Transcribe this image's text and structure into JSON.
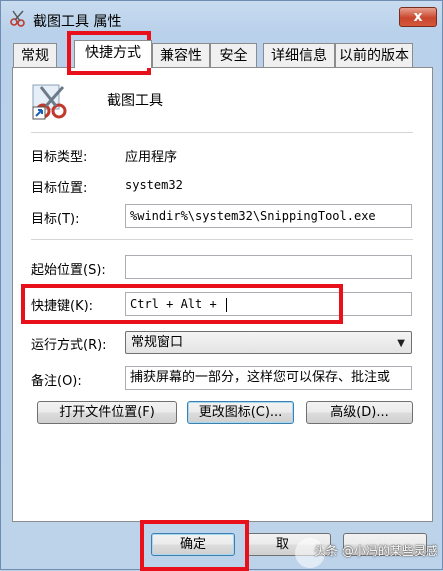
{
  "window": {
    "title": "截图工具 属性",
    "close_label": "x"
  },
  "tabs": [
    {
      "label": "常规"
    },
    {
      "label": "快捷方式"
    },
    {
      "label": "兼容性"
    },
    {
      "label": "安全"
    },
    {
      "label": "详细信息"
    },
    {
      "label": "以前的版本"
    }
  ],
  "shortcut": {
    "name": "截图工具",
    "target_type_label": "目标类型:",
    "target_type": "应用程序",
    "target_location_label": "目标位置:",
    "target_location": "system32",
    "target_label": "目标(T):",
    "target": "%windir%\\system32\\SnippingTool.exe",
    "start_in_label": "起始位置(S):",
    "start_in": "",
    "hotkey_label": "快捷键(K):",
    "hotkey": "Ctrl + Alt + ",
    "run_label": "运行方式(R):",
    "run": "常规窗口",
    "comment_label": "备注(O):",
    "comment": "捕获屏幕的一部分，这样您可以保存、批注或"
  },
  "buttons": {
    "open_location": "打开文件位置(F)",
    "change_icon": "更改图标(C)...",
    "advanced": "高级(D)...",
    "ok": "确定",
    "cancel": "取"
  },
  "watermark": "头条 @小冯的某些灵感",
  "colors": {
    "highlight_box": "#e8101a"
  }
}
